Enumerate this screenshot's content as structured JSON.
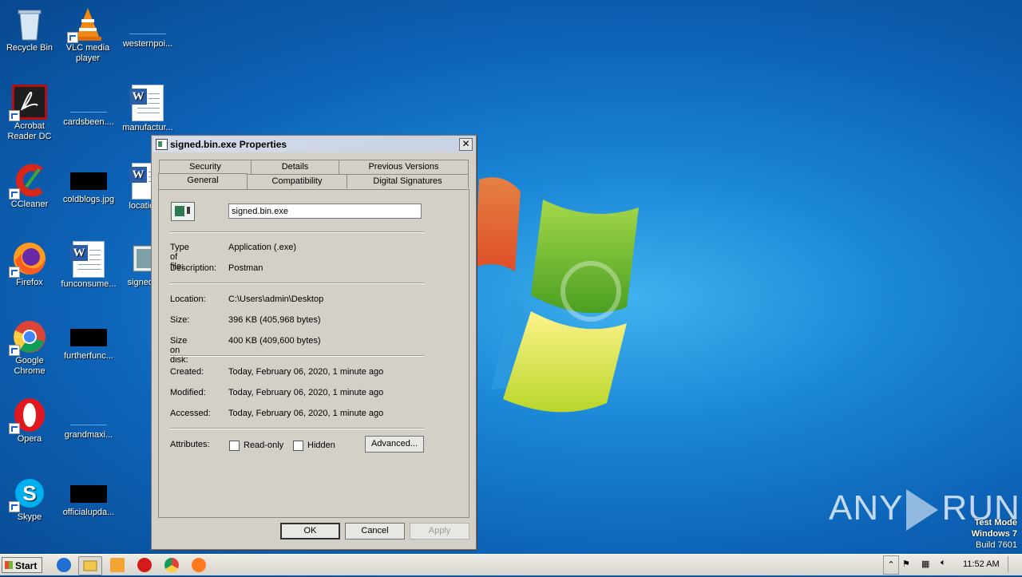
{
  "desktop": {
    "icons": [
      {
        "label": "Recycle Bin"
      },
      {
        "label": "VLC media player"
      },
      {
        "label": "westernpoi..."
      },
      {
        "label": "Acrobat Reader DC"
      },
      {
        "label": "cardsbeen...."
      },
      {
        "label": "manufactur..."
      },
      {
        "label": "CCleaner"
      },
      {
        "label": "coldblogs.jpg"
      },
      {
        "label": "location..."
      },
      {
        "label": "Firefox"
      },
      {
        "label": "funconsume..."
      },
      {
        "label": "signed.b..."
      },
      {
        "label": "Google Chrome"
      },
      {
        "label": "furtherfunc..."
      },
      {
        "label": "Opera"
      },
      {
        "label": "grandmaxi..."
      },
      {
        "label": "Skype"
      },
      {
        "label": "officialupda..."
      }
    ]
  },
  "dialog": {
    "title": "signed.bin.exe Properties",
    "close": "✕",
    "tabs_top": [
      "Security",
      "Details",
      "Previous Versions"
    ],
    "tabs_bottom": [
      "General",
      "Compatibility",
      "Digital Signatures"
    ],
    "active_tab": "General",
    "filename": "signed.bin.exe",
    "type_label": "Type of file:",
    "type_value": "Application (.exe)",
    "desc_label": "Description:",
    "desc_value": "Postman",
    "location_label": "Location:",
    "location_value": "C:\\Users\\admin\\Desktop",
    "size_label": "Size:",
    "size_value": "396 KB (405,968 bytes)",
    "disk_label": "Size on disk:",
    "disk_value": "400 KB (409,600 bytes)",
    "created_label": "Created:",
    "created_value": "Today, February 06, 2020, 1 minute ago",
    "modified_label": "Modified:",
    "modified_value": "Today, February 06, 2020, 1 minute ago",
    "accessed_label": "Accessed:",
    "accessed_value": "Today, February 06, 2020, 1 minute ago",
    "attributes_label": "Attributes:",
    "readonly_label": "Read-only",
    "readonly_checked": false,
    "hidden_label": "Hidden",
    "hidden_checked": false,
    "advanced_label": "Advanced...",
    "ok_label": "OK",
    "cancel_label": "Cancel",
    "apply_label": "Apply"
  },
  "taskbar": {
    "start_label": "Start",
    "clock": "11:52 AM"
  },
  "watermark": {
    "left": "ANY",
    "right": "RUN",
    "test_mode": "Test Mode",
    "os": "Windows 7",
    "build": "Build 7601"
  },
  "colors": {
    "desktop_bg": "#1a86d6",
    "dialog_bg": "#d4d0c8",
    "taskbar_bg": "#d8d5cc"
  }
}
